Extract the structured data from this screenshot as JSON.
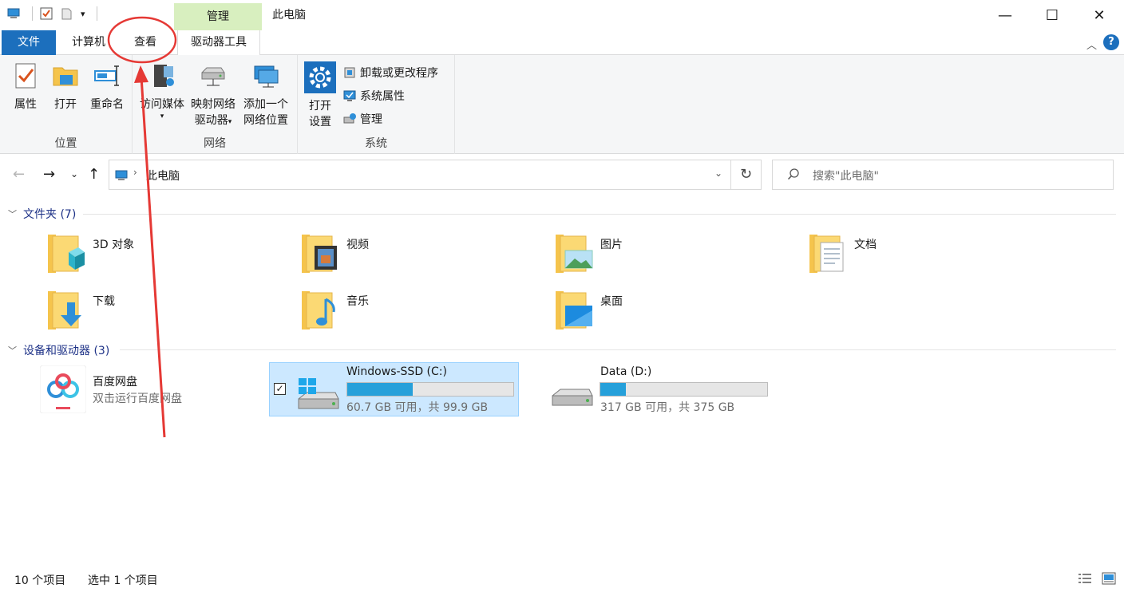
{
  "window": {
    "title": "此电脑",
    "contextual_tab_header": "管理",
    "controls": {
      "minimize": "—",
      "maximize": "☐",
      "close": "✕"
    }
  },
  "tabs": {
    "file": "文件",
    "computer": "计算机",
    "view": "查看",
    "drive_tools": "驱动器工具"
  },
  "ribbon": {
    "location": {
      "label": "位置",
      "properties": "属性",
      "open": "打开",
      "rename": "重命名"
    },
    "network": {
      "label": "网络",
      "access_media": "访问媒体",
      "map_drive_line1": "映射网络",
      "map_drive_line2": "驱动器",
      "add_location_line1": "添加一个",
      "add_location_line2": "网络位置"
    },
    "system": {
      "label": "系统",
      "open_settings_line1": "打开",
      "open_settings_line2": "设置",
      "uninstall": "卸载或更改程序",
      "system_properties": "系统属性",
      "manage": "管理"
    }
  },
  "address": {
    "path": "此电脑",
    "search_placeholder": "搜索\"此电脑\""
  },
  "folders_section": {
    "title": "文件夹 (7)",
    "items": [
      {
        "name": "3D 对象"
      },
      {
        "name": "视频"
      },
      {
        "name": "图片"
      },
      {
        "name": "文档"
      },
      {
        "name": "下载"
      },
      {
        "name": "音乐"
      },
      {
        "name": "桌面"
      }
    ]
  },
  "devices_section": {
    "title": "设备和驱动器 (3)",
    "baidu": {
      "name": "百度网盘",
      "sub": "双击运行百度网盘"
    },
    "drives": [
      {
        "name": "Windows-SSD (C:)",
        "free": "60.7 GB 可用，共 99.9 GB",
        "used_fraction": 0.392
      },
      {
        "name": "Data (D:)",
        "free": "317 GB 可用，共 375 GB",
        "used_fraction": 0.155
      }
    ]
  },
  "status": {
    "count": "10 个项目",
    "selected": "选中 1 个项目"
  },
  "colors": {
    "accent": "#1c6fbd",
    "manage_tab": "#d8efbf",
    "selection": "#cce8ff",
    "bar_fill": "#26a0da",
    "annotation": "#e53935"
  }
}
